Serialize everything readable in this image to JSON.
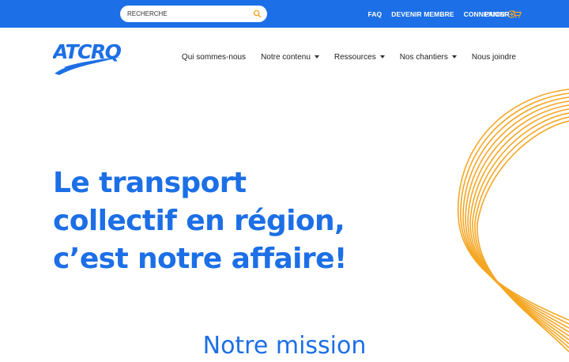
{
  "search": {
    "placeholder": "RECHERCHE",
    "icon": "search-icon"
  },
  "topbar": {
    "links": [
      {
        "label": "FAQ"
      },
      {
        "label": "DEVENIR MEMBRE"
      },
      {
        "label": "CONNEXION",
        "icon": "login-arrow-icon"
      },
      {
        "label": "PANIER",
        "icon": "cart-icon"
      }
    ],
    "background": "#1c6fe6",
    "accent": "#f5a623"
  },
  "logo": {
    "text": "ATCRQ"
  },
  "nav": {
    "items": [
      {
        "label": "Qui sommes-nous"
      },
      {
        "label": "Notre contenu"
      },
      {
        "label": "Ressources"
      },
      {
        "label": "Nos chantiers"
      },
      {
        "label": "Nous joindre"
      }
    ]
  },
  "hero": {
    "lines": [
      "Le transport",
      "collectif en région,",
      "c’est notre affaire!"
    ],
    "color": "#1c6fe6"
  },
  "mission": {
    "title": "Notre mission"
  },
  "decor": {
    "wave_color": "#f5a623"
  }
}
